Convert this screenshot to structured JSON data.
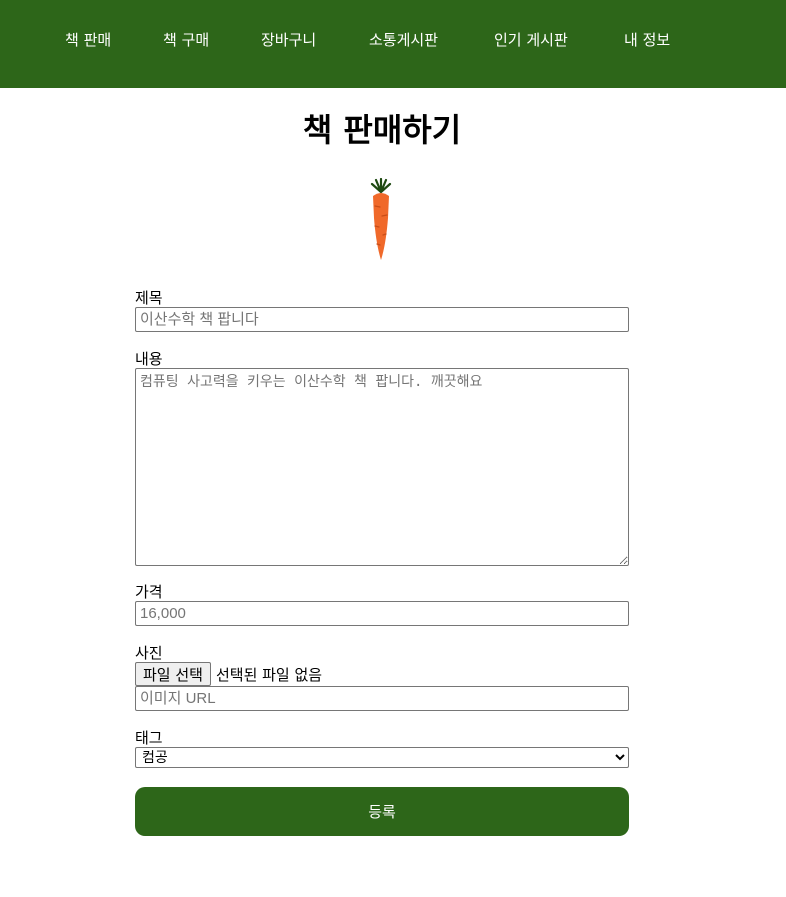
{
  "nav": {
    "items": [
      {
        "label": "책 판매"
      },
      {
        "label": "책 구매"
      },
      {
        "label": "장바구니"
      },
      {
        "label": "소통게시판"
      },
      {
        "label": "인기 게시판"
      },
      {
        "label": "내 정보"
      }
    ]
  },
  "page": {
    "title": "책 판매하기",
    "logo_icon": "carrot-icon"
  },
  "form": {
    "title_label": "제목",
    "title_placeholder": "이산수학 책 팝니다",
    "content_label": "내용",
    "content_placeholder": "컴퓨팅 사고력을 키우는 이산수학 책 팝니다. 깨끗해요",
    "price_label": "가격",
    "price_placeholder": "16,000",
    "photo_label": "사진",
    "file_button_label": "파일 선택",
    "file_status": "선택된 파일 없음",
    "image_url_placeholder": "이미지 URL",
    "tag_label": "태그",
    "tag_selected": "컴공",
    "submit_label": "등록"
  },
  "colors": {
    "brand_green": "#2d6619",
    "carrot_orange": "#f0692a",
    "carrot_leaf": "#1f4a12"
  }
}
